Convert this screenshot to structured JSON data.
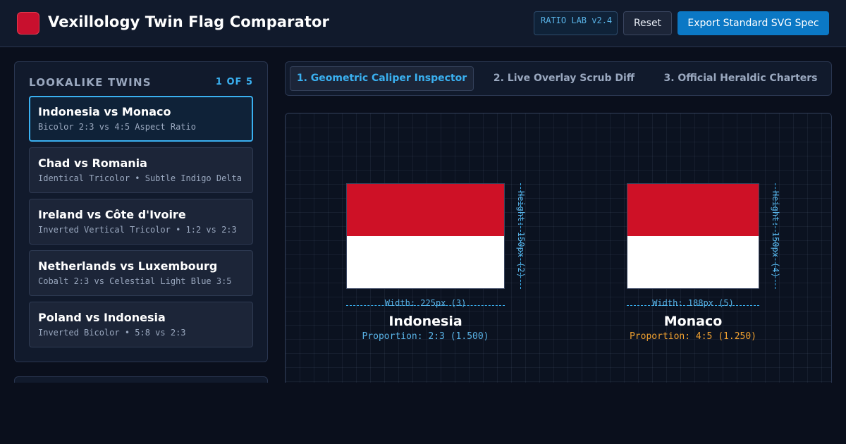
{
  "app": {
    "title": "Vexillology Twin Flag Comparator",
    "version": "RATIO LAB v2.4",
    "reset_label": "Reset",
    "export_label": "Export Standard SVG Spec",
    "logo_icon": "red-flag-square-icon",
    "accent_color": "#3ab0f0"
  },
  "sidebar": {
    "heading": "LOOKALIKE TWINS",
    "count": "1 OF 5",
    "items": [
      {
        "title": "Indonesia vs Monaco",
        "subtitle": "Bicolor 2:3 vs 4:5 Aspect Ratio",
        "active": true
      },
      {
        "title": "Chad vs Romania",
        "subtitle": "Identical Tricolor • Subtle Indigo Delta",
        "active": false
      },
      {
        "title": "Ireland vs Côte d'Ivoire",
        "subtitle": "Inverted Vertical Tricolor • 1:2 vs 2:3",
        "active": false
      },
      {
        "title": "Netherlands vs Luxembourg",
        "subtitle": "Cobalt 2:3 vs Celestial Light Blue 3:5",
        "active": false
      },
      {
        "title": "Poland vs Indonesia",
        "subtitle": "Inverted Bicolor • 5:8 vs 2:3",
        "active": false
      }
    ]
  },
  "tabs": [
    {
      "label": "1. Geometric Caliper Inspector",
      "active": true
    },
    {
      "label": "2. Live Overlay Scrub Diff",
      "active": false
    },
    {
      "label": "3. Official Heraldic Charters",
      "active": false
    }
  ],
  "inspector": {
    "flags": [
      {
        "name": "Indonesia",
        "colors": [
          "#ce1126",
          "#ffffff"
        ],
        "height_label": "Height: 150px (2)",
        "width_label": "Width: 225px (3)",
        "proportion": "Proportion: 2:3 (1.500)",
        "proportion_color": "#5ab4e8"
      },
      {
        "name": "Monaco",
        "colors": [
          "#ce1126",
          "#ffffff"
        ],
        "height_label": "Height: 150px (4)",
        "width_label": "Width: 188px (5)",
        "proportion": "Proportion: 4:5 (1.250)",
        "proportion_color": "#f0a030"
      }
    ]
  }
}
